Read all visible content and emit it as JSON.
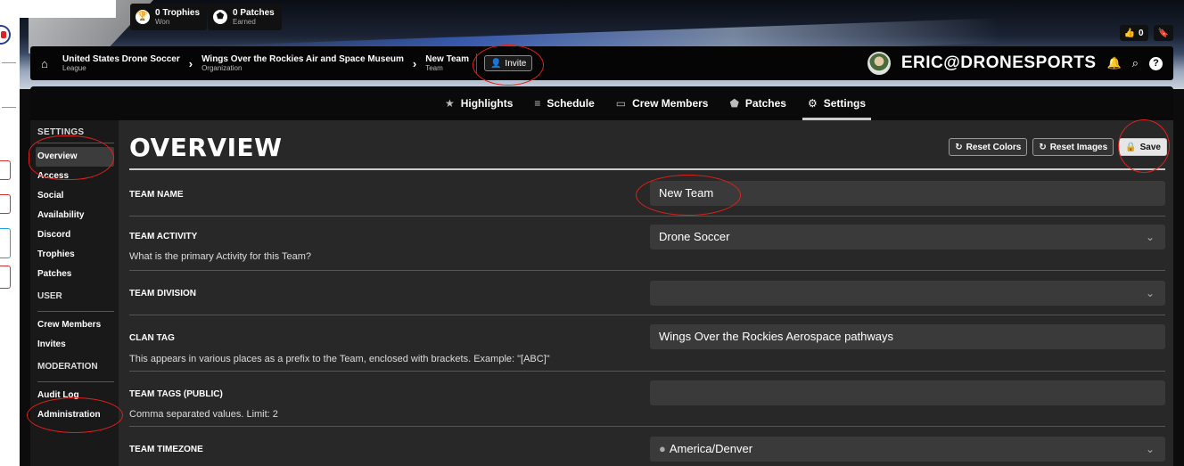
{
  "stats": [
    {
      "value": "0 Trophies",
      "sub": "Won",
      "icon": "trophy-icon"
    },
    {
      "value": "0 Patches",
      "sub": "Earned",
      "icon": "shield-icon"
    }
  ],
  "top_right": {
    "likes": "0"
  },
  "breadcrumb": [
    {
      "title": "United States Drone Soccer",
      "sub": "League"
    },
    {
      "title": "Wings Over the Rockies Air and Space Museum",
      "sub": "Organization"
    },
    {
      "title": "New Team",
      "sub": "Team"
    }
  ],
  "invite_label": "Invite",
  "user": {
    "name": "ERIC@DRONESPORTS"
  },
  "tabs": [
    {
      "label": "Highlights",
      "icon": "star-icon",
      "active": false
    },
    {
      "label": "Schedule",
      "icon": "list-icon",
      "active": false
    },
    {
      "label": "Crew Members",
      "icon": "users-icon",
      "active": false
    },
    {
      "label": "Patches",
      "icon": "shield-icon",
      "active": false
    },
    {
      "label": "Settings",
      "icon": "gear-icon",
      "active": true
    }
  ],
  "sidebar": {
    "settings_head": "SETTINGS",
    "settings_items": [
      "Overview",
      "Access",
      "Social",
      "Availability",
      "Discord",
      "Trophies",
      "Patches"
    ],
    "user_head": "USER",
    "user_items": [
      "Crew Members",
      "Invites"
    ],
    "moderation_head": "MODERATION",
    "moderation_items": [
      "Audit Log",
      "Administration"
    ]
  },
  "page": {
    "title": "OVERVIEW",
    "reset_colors": "Reset Colors",
    "reset_images": "Reset Images",
    "save": "Save"
  },
  "form": {
    "team_name": {
      "label": "TEAM NAME",
      "value": "New Team"
    },
    "team_activity": {
      "label": "TEAM ACTIVITY",
      "help": "What is the primary Activity for this Team?",
      "value": "Drone Soccer"
    },
    "team_division": {
      "label": "TEAM DIVISION",
      "value": ""
    },
    "clan_tag": {
      "label": "CLAN TAG",
      "help": "This appears in various places as a prefix to the Team, enclosed with brackets. Example: \"[ABC]\"",
      "value": "Wings Over the Rockies Aerospace pathways"
    },
    "team_tags": {
      "label": "TEAM TAGS (PUBLIC)",
      "help": "Comma separated values. Limit: 2",
      "value": ""
    },
    "team_timezone": {
      "label": "TEAM TIMEZONE",
      "value": "America/Denver"
    }
  },
  "colors": {
    "annotation": "#e0201b",
    "app_bg": "#0c0c0c",
    "card_bg": "#282828"
  }
}
